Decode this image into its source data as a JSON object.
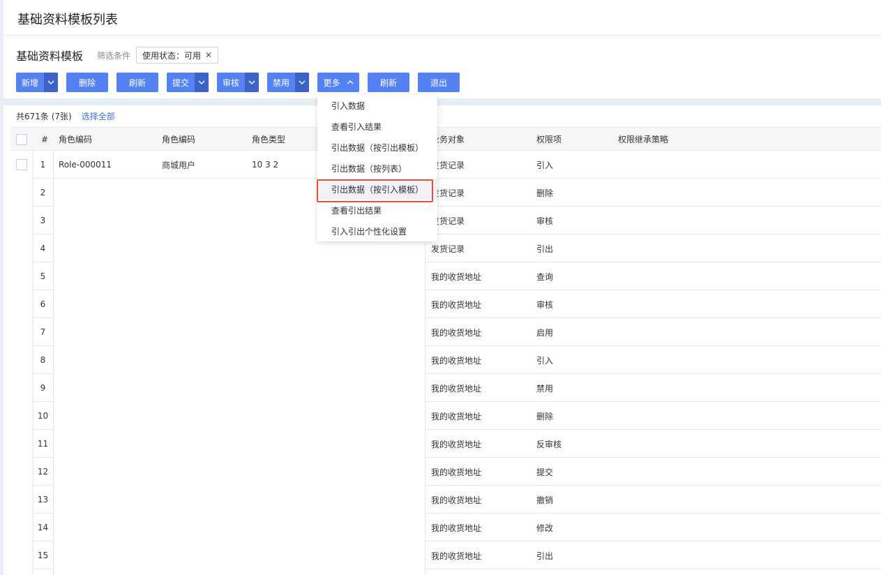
{
  "page_title": "基础资料模板列表",
  "section_title": "基础资料模板",
  "filter": {
    "label": "筛选条件",
    "chip": "使用状态：可用",
    "chip_close": "✕"
  },
  "toolbar": {
    "new": "新增",
    "delete": "删除",
    "refresh": "刷新",
    "submit": "提交",
    "audit": "审核",
    "disable": "禁用",
    "more": "更多",
    "refresh2": "刷新",
    "exit": "退出"
  },
  "accent_color": "#5582f3",
  "highlight_color": "#e8503a",
  "list_info": {
    "count": "共671条 (7张)",
    "select_all": "选择全部"
  },
  "columns": [
    "#",
    "角色编码",
    "角色编码",
    "角色类型",
    "业务对象",
    "权限项",
    "权限继承策略"
  ],
  "rows": [
    {
      "no": "1",
      "code": "Role-000011",
      "name": "商城用户",
      "type": "10 3 2",
      "object": "发货记录",
      "perm": "引入"
    },
    {
      "no": "2",
      "code": "",
      "name": "",
      "type": "",
      "object": "发货记录",
      "perm": "删除"
    },
    {
      "no": "3",
      "code": "",
      "name": "",
      "type": "",
      "object": "发货记录",
      "perm": "审核"
    },
    {
      "no": "4",
      "code": "",
      "name": "",
      "type": "",
      "object": "发货记录",
      "perm": "引出"
    },
    {
      "no": "5",
      "code": "",
      "name": "",
      "type": "",
      "object": "我的收货地址",
      "perm": "查询"
    },
    {
      "no": "6",
      "code": "",
      "name": "",
      "type": "",
      "object": "我的收货地址",
      "perm": "审核"
    },
    {
      "no": "7",
      "code": "",
      "name": "",
      "type": "",
      "object": "我的收货地址",
      "perm": "启用"
    },
    {
      "no": "8",
      "code": "",
      "name": "",
      "type": "",
      "object": "我的收货地址",
      "perm": "引入"
    },
    {
      "no": "9",
      "code": "",
      "name": "",
      "type": "",
      "object": "我的收货地址",
      "perm": "禁用"
    },
    {
      "no": "10",
      "code": "",
      "name": "",
      "type": "",
      "object": "我的收货地址",
      "perm": "删除"
    },
    {
      "no": "11",
      "code": "",
      "name": "",
      "type": "",
      "object": "我的收货地址",
      "perm": "反审核"
    },
    {
      "no": "12",
      "code": "",
      "name": "",
      "type": "",
      "object": "我的收货地址",
      "perm": "提交"
    },
    {
      "no": "13",
      "code": "",
      "name": "",
      "type": "",
      "object": "我的收货地址",
      "perm": "撤销"
    },
    {
      "no": "14",
      "code": "",
      "name": "",
      "type": "",
      "object": "我的收货地址",
      "perm": "修改"
    },
    {
      "no": "15",
      "code": "",
      "name": "",
      "type": "",
      "object": "我的收货地址",
      "perm": "引出"
    }
  ],
  "more_menu": [
    "引入数据",
    "查看引入结果",
    "引出数据（按引出模板）",
    "引出数据（按列表）",
    "引出数据（按引入模板）",
    "查看引出结果",
    "引入引出个性化设置"
  ]
}
